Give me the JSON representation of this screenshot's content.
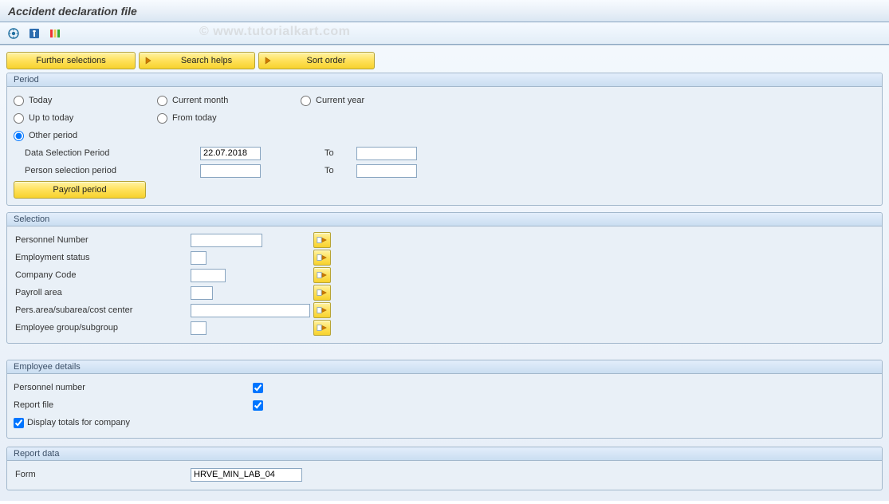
{
  "window": {
    "title": "Accident declaration file"
  },
  "watermark": "© www.tutorialkart.com",
  "buttons": {
    "further_selections": "Further selections",
    "search_helps": "Search helps",
    "sort_order": "Sort order",
    "payroll_period": "Payroll period"
  },
  "groups": {
    "period": "Period",
    "selection": "Selection",
    "employee_details": "Employee details",
    "report_data": "Report data"
  },
  "period": {
    "today": "Today",
    "current_month": "Current month",
    "current_year": "Current year",
    "up_to_today": "Up to today",
    "from_today": "From today",
    "other_period": "Other period",
    "data_selection_period": "Data Selection Period",
    "person_selection_period": "Person selection period",
    "to": "To",
    "data_from_value": "22.07.2018",
    "data_to_value": "",
    "person_from_value": "",
    "person_to_value": ""
  },
  "selection": {
    "personnel_number": "Personnel Number",
    "employment_status": "Employment status",
    "company_code": "Company Code",
    "payroll_area": "Payroll area",
    "pers_area": "Pers.area/subarea/cost center",
    "employee_group": "Employee group/subgroup",
    "values": {
      "personnel_number": "",
      "employment_status": "",
      "company_code": "",
      "payroll_area": "",
      "pers_area": "",
      "employee_group": ""
    }
  },
  "employee_details": {
    "personnel_number": "Personnel number",
    "report_file": "Report file",
    "display_totals": "Display totals for company"
  },
  "report_data": {
    "form": "Form",
    "form_value": "HRVE_MIN_LAB_04"
  }
}
